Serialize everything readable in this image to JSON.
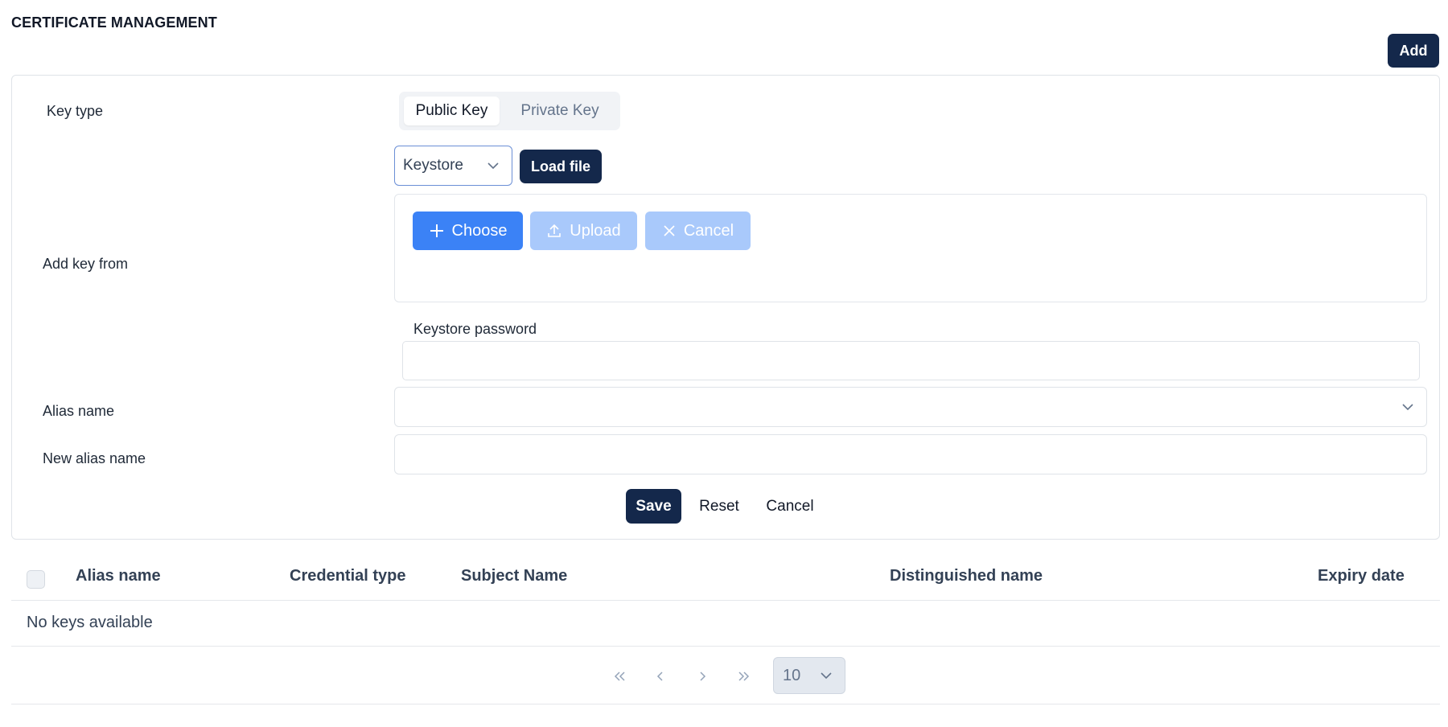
{
  "page": {
    "title": "CERTIFICATE MANAGEMENT",
    "add_label": "Add"
  },
  "form": {
    "key_type_label": "Key type",
    "key_types": [
      "Public Key",
      "Private Key"
    ],
    "selected_key_type": "Public Key",
    "add_key_from_label": "Add key from",
    "source_select_value": "Keystore",
    "load_file_label": "Load file",
    "upload": {
      "choose_label": "Choose",
      "upload_label": "Upload",
      "cancel_label": "Cancel"
    },
    "keystore_password_label": "Keystore password",
    "keystore_password_value": "",
    "alias_name_label": "Alias name",
    "alias_name_value": "",
    "new_alias_name_label": "New alias name",
    "new_alias_name_value": "",
    "save_label": "Save",
    "reset_label": "Reset",
    "cancel_label": "Cancel"
  },
  "table": {
    "columns": [
      "Alias name",
      "Credential type",
      "Subject Name",
      "Distinguished name",
      "Expiry date"
    ],
    "rows": [],
    "empty_message": "No keys available"
  },
  "pagination": {
    "page_size": "10",
    "icons": [
      "first-page-icon",
      "prev-page-icon",
      "next-page-icon",
      "last-page-icon"
    ]
  },
  "colors": {
    "primary_dark": "#14284b",
    "choose_blue": "#3b82f6",
    "disabled_blue": "#a9c9fb",
    "border": "#dfe3e8"
  }
}
